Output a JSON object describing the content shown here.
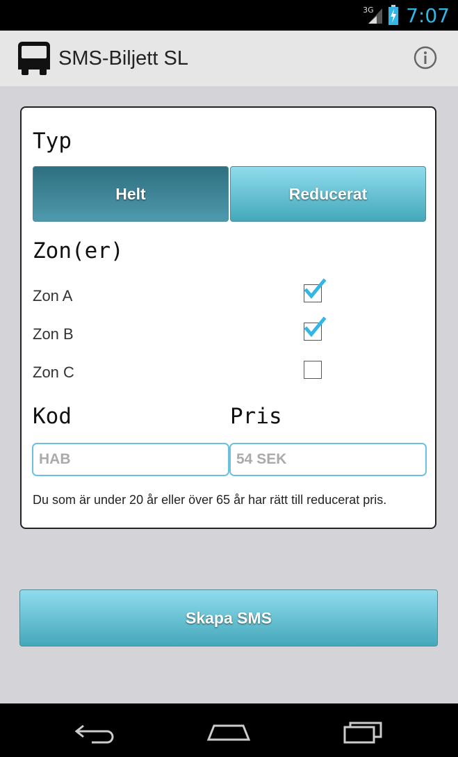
{
  "status_bar": {
    "network_type": "3G",
    "time": "7:07",
    "icons": [
      "signal-icon",
      "battery-charging-icon"
    ],
    "accent_color": "#33b5e5"
  },
  "app_bar": {
    "title": "SMS-Biljett SL",
    "icons": [
      "bus-icon",
      "info-icon"
    ]
  },
  "card": {
    "type_heading": "Typ",
    "type_options": [
      {
        "label": "Helt",
        "selected": true
      },
      {
        "label": "Reducerat",
        "selected": false
      }
    ],
    "zones_heading": "Zon(er)",
    "zones": [
      {
        "label": "Zon A",
        "checked": true
      },
      {
        "label": "Zon B",
        "checked": true
      },
      {
        "label": "Zon C",
        "checked": false
      }
    ],
    "code_heading": "Kod",
    "price_heading": "Pris",
    "code_placeholder": "HAB",
    "price_placeholder": "54 SEK",
    "note": "Du som är under 20 år eller över 65 år har rätt till reducerat pris."
  },
  "actions": {
    "create_sms_label": "Skapa SMS"
  },
  "nav_bar": {
    "icons": [
      "back-icon",
      "home-icon",
      "recent-apps-icon"
    ]
  },
  "colors": {
    "selected_segment": "#2e6f80",
    "button_light": "#8fdced",
    "field_border": "#6cc0dd",
    "check_blue": "#33b5e5"
  }
}
